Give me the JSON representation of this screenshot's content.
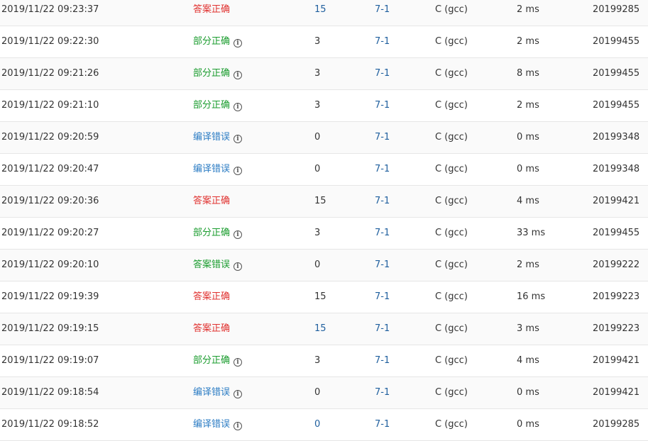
{
  "submissions": [
    {
      "time": "2019/11/22 09:23:37",
      "status": "答案正确",
      "status_type": "ac",
      "info": false,
      "score": "15",
      "score_link": true,
      "problem": "7-1",
      "language": "C (gcc)",
      "time_used": "2 ms",
      "user": "20199285"
    },
    {
      "time": "2019/11/22 09:22:30",
      "status": "部分正确",
      "status_type": "pa",
      "info": true,
      "score": "3",
      "score_link": false,
      "problem": "7-1",
      "language": "C (gcc)",
      "time_used": "2 ms",
      "user": "20199455"
    },
    {
      "time": "2019/11/22 09:21:26",
      "status": "部分正确",
      "status_type": "pa",
      "info": true,
      "score": "3",
      "score_link": false,
      "problem": "7-1",
      "language": "C (gcc)",
      "time_used": "8 ms",
      "user": "20199455"
    },
    {
      "time": "2019/11/22 09:21:10",
      "status": "部分正确",
      "status_type": "pa",
      "info": true,
      "score": "3",
      "score_link": false,
      "problem": "7-1",
      "language": "C (gcc)",
      "time_used": "2 ms",
      "user": "20199455"
    },
    {
      "time": "2019/11/22 09:20:59",
      "status": "编译错误",
      "status_type": "ce",
      "info": true,
      "score": "0",
      "score_link": false,
      "problem": "7-1",
      "language": "C (gcc)",
      "time_used": "0 ms",
      "user": "20199348"
    },
    {
      "time": "2019/11/22 09:20:47",
      "status": "编译错误",
      "status_type": "ce",
      "info": true,
      "score": "0",
      "score_link": false,
      "problem": "7-1",
      "language": "C (gcc)",
      "time_used": "0 ms",
      "user": "20199348"
    },
    {
      "time": "2019/11/22 09:20:36",
      "status": "答案正确",
      "status_type": "ac",
      "info": false,
      "score": "15",
      "score_link": false,
      "problem": "7-1",
      "language": "C (gcc)",
      "time_used": "4 ms",
      "user": "20199421"
    },
    {
      "time": "2019/11/22 09:20:27",
      "status": "部分正确",
      "status_type": "pa",
      "info": true,
      "score": "3",
      "score_link": false,
      "problem": "7-1",
      "language": "C (gcc)",
      "time_used": "33 ms",
      "user": "20199455"
    },
    {
      "time": "2019/11/22 09:20:10",
      "status": "答案错误",
      "status_type": "wa",
      "info": true,
      "score": "0",
      "score_link": false,
      "problem": "7-1",
      "language": "C (gcc)",
      "time_used": "2 ms",
      "user": "20199222"
    },
    {
      "time": "2019/11/22 09:19:39",
      "status": "答案正确",
      "status_type": "ac",
      "info": false,
      "score": "15",
      "score_link": false,
      "problem": "7-1",
      "language": "C (gcc)",
      "time_used": "16 ms",
      "user": "20199223"
    },
    {
      "time": "2019/11/22 09:19:15",
      "status": "答案正确",
      "status_type": "ac",
      "info": false,
      "score": "15",
      "score_link": true,
      "problem": "7-1",
      "language": "C (gcc)",
      "time_used": "3 ms",
      "user": "20199223"
    },
    {
      "time": "2019/11/22 09:19:07",
      "status": "部分正确",
      "status_type": "pa",
      "info": true,
      "score": "3",
      "score_link": false,
      "problem": "7-1",
      "language": "C (gcc)",
      "time_used": "4 ms",
      "user": "20199421"
    },
    {
      "time": "2019/11/22 09:18:54",
      "status": "编译错误",
      "status_type": "ce",
      "info": true,
      "score": "0",
      "score_link": false,
      "problem": "7-1",
      "language": "C (gcc)",
      "time_used": "0 ms",
      "user": "20199421"
    },
    {
      "time": "2019/11/22 09:18:52",
      "status": "编译错误",
      "status_type": "ce",
      "info": true,
      "score": "0",
      "score_link": true,
      "problem": "7-1",
      "language": "C (gcc)",
      "time_used": "0 ms",
      "user": "20199285"
    }
  ],
  "icons": {
    "info": "info-circle-icon",
    "info_glyph": "i"
  },
  "colors": {
    "accepted": "#e0312f",
    "partial": "#1a9c2e",
    "wrong": "#1a9c2e",
    "compile_error": "#2b7cc4",
    "link": "#1f5f9e"
  }
}
